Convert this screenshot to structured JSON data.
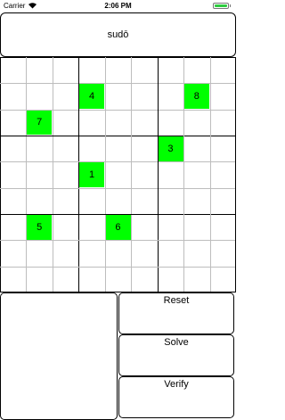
{
  "status_bar": {
    "carrier": "Carrier",
    "time": "2:06 PM"
  },
  "header": {
    "title": "sudō"
  },
  "board": {
    "givens": [
      {
        "row": 1,
        "col": 3,
        "value": "4"
      },
      {
        "row": 1,
        "col": 7,
        "value": "8"
      },
      {
        "row": 2,
        "col": 1,
        "value": "7"
      },
      {
        "row": 3,
        "col": 6,
        "value": "3"
      },
      {
        "row": 4,
        "col": 3,
        "value": "1"
      },
      {
        "row": 6,
        "col": 1,
        "value": "5"
      },
      {
        "row": 6,
        "col": 4,
        "value": "6"
      }
    ],
    "given_color": "#00ff00"
  },
  "buttons": {
    "reset": "Reset",
    "solve": "Solve",
    "verify": "Verify"
  }
}
